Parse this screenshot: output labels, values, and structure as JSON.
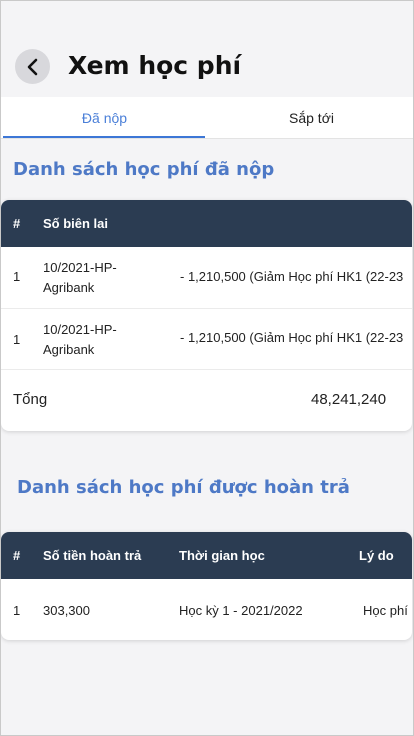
{
  "header": {
    "title": "Xem học phí"
  },
  "tabs": [
    {
      "label": "Đã nộp",
      "active": true
    },
    {
      "label": "Sắp tới",
      "active": false
    }
  ],
  "paid": {
    "title": "Danh sách học phí đã nộp",
    "columns": [
      "#",
      "Số biên lai"
    ],
    "rows": [
      {
        "index": "1",
        "receipt_line1": "10/2021-HP-",
        "receipt_line2": "Agribank",
        "detail": "- 1,210,500 (Giảm Học phí HK1 (22-23"
      },
      {
        "index": "1",
        "receipt_line1": "10/2021-HP-",
        "receipt_line2": "Agribank",
        "detail": "- 1,210,500 (Giảm Học phí HK1 (22-23"
      }
    ],
    "total_label": "Tổng",
    "total_value": "48,241,240"
  },
  "refund": {
    "title": "Danh sách học phí được hoàn trả",
    "columns": [
      "#",
      "Số tiền hoàn trả",
      "Thời gian học",
      "Lý do"
    ],
    "rows": [
      {
        "index": "1",
        "amount": "303,300",
        "period": "Học kỳ 1 - 2021/2022",
        "reason": "Học phí"
      }
    ]
  },
  "colors": {
    "accent": "#4a7fd8",
    "table_header": "#2b3c52",
    "section_title": "#4e79c6"
  }
}
